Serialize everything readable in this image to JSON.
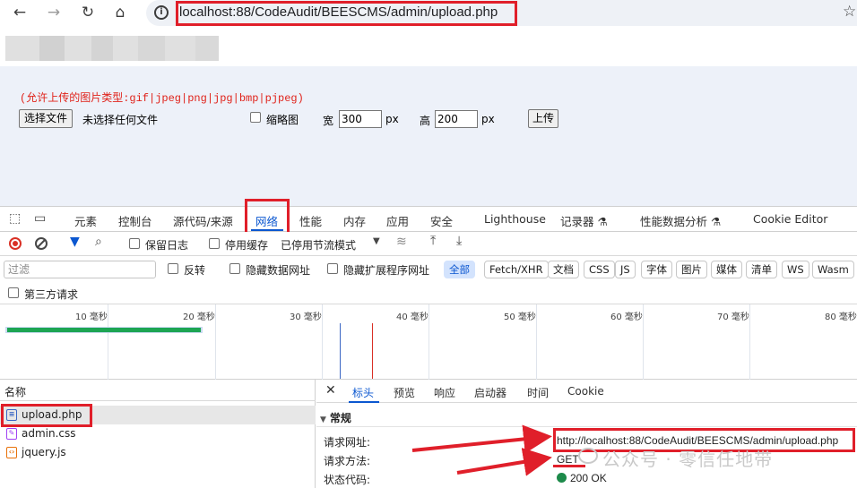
{
  "browser": {
    "url": "localhost:88/CodeAudit/BEESCMS/admin/upload.php",
    "back_icon": "←",
    "forward_icon": "→",
    "reload_icon": "↻",
    "home_icon": "⌂",
    "info_icon": "i",
    "star_icon": "☆"
  },
  "page": {
    "allowed_types": "(允许上传的图片类型:gif|jpeg|png|jpg|bmp|pjpeg)",
    "choose_file_button": "选择文件",
    "no_file_text": "未选择任何文件",
    "thumbnail_label": "缩略图",
    "width_label": "宽",
    "width_value": "300",
    "width_unit": "px",
    "height_label": "高",
    "height_value": "200",
    "height_unit": "px",
    "upload_button": "上传"
  },
  "devtools": {
    "tabs": [
      "元素",
      "控制台",
      "源代码/来源",
      "网络",
      "性能",
      "内存",
      "应用",
      "安全",
      "Lighthouse",
      "记录器 ⚗",
      "性能数据分析 ⚗",
      "Cookie Editor"
    ],
    "active_tab": "网络",
    "network_toolbar": {
      "preserve_log": "保留日志",
      "disable_cache": "停用缓存",
      "throttling": "已停用节流模式"
    },
    "filter": {
      "placeholder": "过滤",
      "invert": "反转",
      "hide_data_urls": "隐藏数据网址",
      "hide_extension_urls": "隐藏扩展程序网址",
      "types": [
        "全部",
        "Fetch/XHR",
        "文档",
        "CSS",
        "JS",
        "字体",
        "图片",
        "媒体",
        "清单",
        "WS",
        "Wasm"
      ],
      "third_party": "第三方请求"
    },
    "timeline_labels": [
      "10 毫秒",
      "20 毫秒",
      "30 毫秒",
      "40 毫秒",
      "50 毫秒",
      "60 毫秒",
      "70 毫秒",
      "80 毫秒"
    ],
    "requests": {
      "header": "名称",
      "rows": [
        {
          "name": "upload.php",
          "type": "document"
        },
        {
          "name": "admin.css",
          "type": "stylesheet"
        },
        {
          "name": "jquery.js",
          "type": "script"
        }
      ]
    },
    "detail": {
      "tabs": [
        "标头",
        "预览",
        "响应",
        "启动器",
        "时间",
        "Cookie"
      ],
      "active_tab": "标头",
      "section": "常规",
      "request_url_label": "请求网址:",
      "request_url": "http://localhost:88/CodeAudit/BEESCMS/admin/upload.php",
      "method_label": "请求方法:",
      "method": "GET",
      "status_label": "状态代码:",
      "status": "200 OK"
    }
  },
  "watermark": "公众号 · 零信任地带",
  "colors": {
    "highlight": "#e01f2a",
    "accent": "#0b57d0",
    "error_text": "#e0231b"
  }
}
